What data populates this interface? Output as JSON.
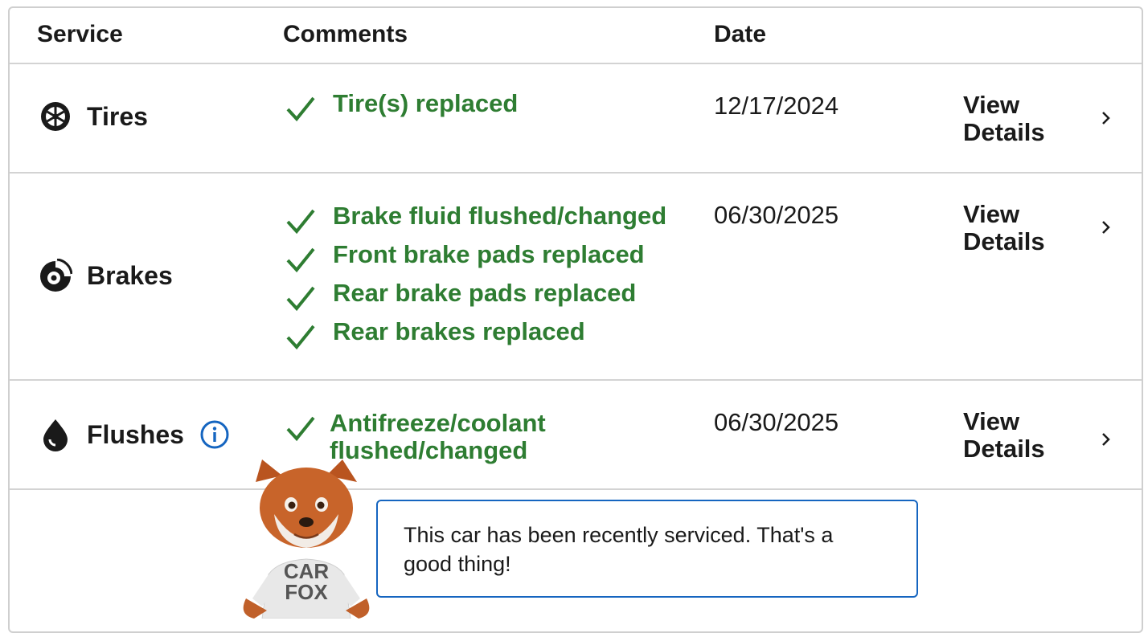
{
  "headers": {
    "service": "Service",
    "comments": "Comments",
    "date": "Date"
  },
  "rows": [
    {
      "service": "Tires",
      "icon": "tire-icon",
      "comments": [
        "Tire(s) replaced"
      ],
      "date": "12/17/2024",
      "details_label_line1": "View",
      "details_label_line2": "Details"
    },
    {
      "service": "Brakes",
      "icon": "brake-icon",
      "comments": [
        "Brake fluid flushed/changed",
        "Front brake pads replaced",
        "Rear brake pads replaced",
        "Rear brakes replaced"
      ],
      "date": "06/30/2025",
      "details_label_line1": "View",
      "details_label_line2": "Details"
    },
    {
      "service": "Flushes",
      "icon": "drop-icon",
      "comments": [
        "Antifreeze/coolant",
        "flushed/changed"
      ],
      "date": "06/30/2025",
      "details_label_line1": "View",
      "details_label_line2": "Details"
    }
  ],
  "tooltip": {
    "text_line1": "This car has been recently serviced. That's a",
    "text_line2": "good thing!"
  },
  "mascot": {
    "shirt_line1": "CAR",
    "shirt_line2": "FOX"
  },
  "colors": {
    "check_green": "#2e7d32",
    "info_blue": "#1565c0",
    "border": "#cfcfcf"
  }
}
